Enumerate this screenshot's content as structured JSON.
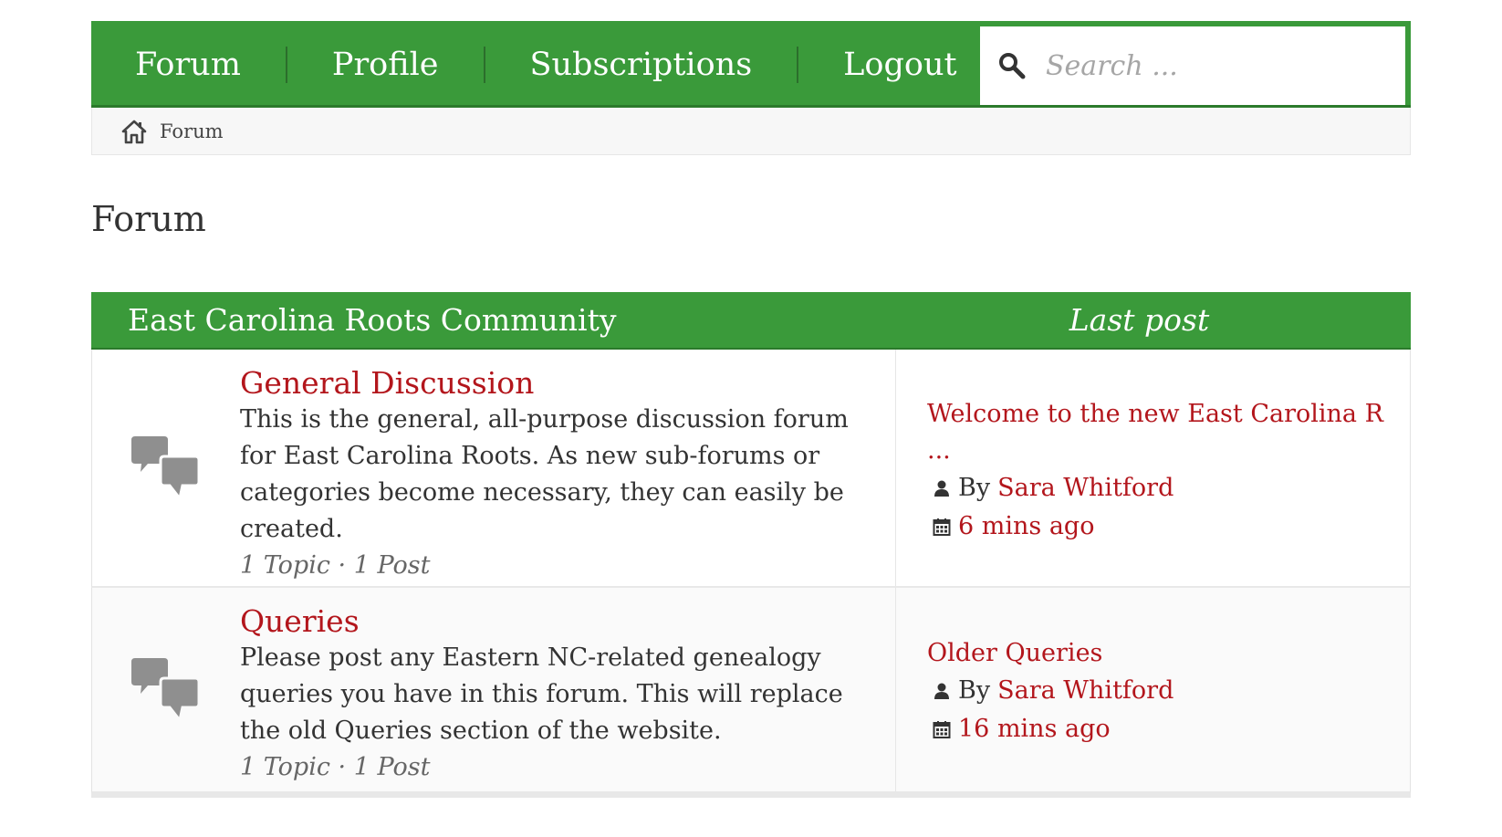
{
  "nav": {
    "items": [
      {
        "label": "Forum"
      },
      {
        "label": "Profile"
      },
      {
        "label": "Subscriptions"
      },
      {
        "label": "Logout"
      }
    ],
    "search": {
      "placeholder": "Search ..."
    }
  },
  "breadcrumb": {
    "items": [
      {
        "label": "Forum"
      }
    ]
  },
  "page_title": "Forum",
  "category": {
    "title": "East Carolina Roots Community",
    "last_post_header": "Last post",
    "forums": [
      {
        "title": "General Discussion",
        "description": "This is the general, all-purpose discussion forum for East Carolina Roots. As new sub-forums or categories become necessary, they can easily be created.",
        "stats": "1 Topic · 1 Post",
        "last_post": {
          "title": "Welcome to the new East Carolina R\n...",
          "by_label": "By",
          "author": "Sara Whitford",
          "time": "6 mins ago"
        }
      },
      {
        "title": "Queries",
        "description": "Please post any Eastern NC-related genealogy queries you have in this forum. This will replace the old Queries section of the website.",
        "stats": "1 Topic · 1 Post",
        "last_post": {
          "title": "Older Queries",
          "by_label": "By",
          "author": "Sara Whitford",
          "time": "16 mins ago"
        }
      }
    ]
  },
  "colors": {
    "primary_green": "#3a9a3a",
    "link_red": "#b3161c",
    "icon_gray": "#8f8f8f"
  },
  "icons": {
    "search": "search-icon",
    "home": "home-icon",
    "forum": "speech-bubbles-icon",
    "user": "user-icon",
    "calendar": "calendar-icon"
  }
}
